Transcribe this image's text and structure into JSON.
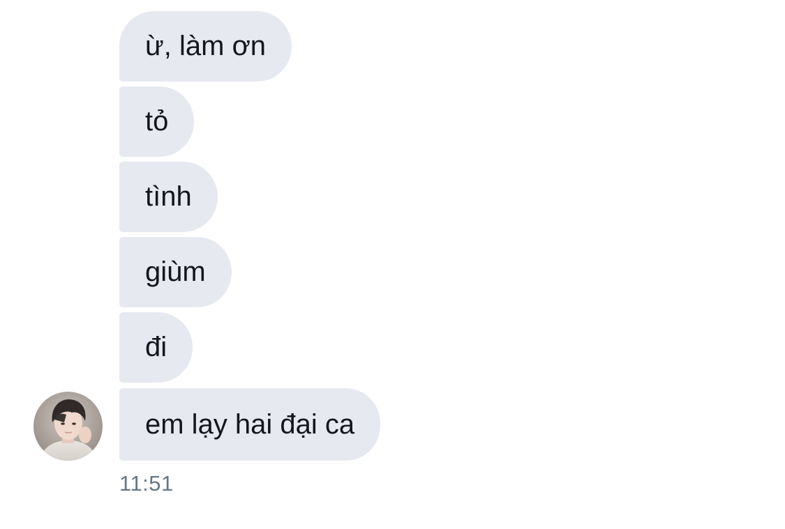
{
  "conversation": {
    "messages": [
      {
        "text": "ừ, làm ơn"
      },
      {
        "text": "tỏ"
      },
      {
        "text": "tình"
      },
      {
        "text": "giùm"
      },
      {
        "text": "đi"
      },
      {
        "text": "em lạy hai đại ca"
      }
    ],
    "timestamp": "11:51",
    "bubble_color": "#e6e9f0",
    "text_color": "#14171a",
    "timestamp_color": "#657786"
  }
}
